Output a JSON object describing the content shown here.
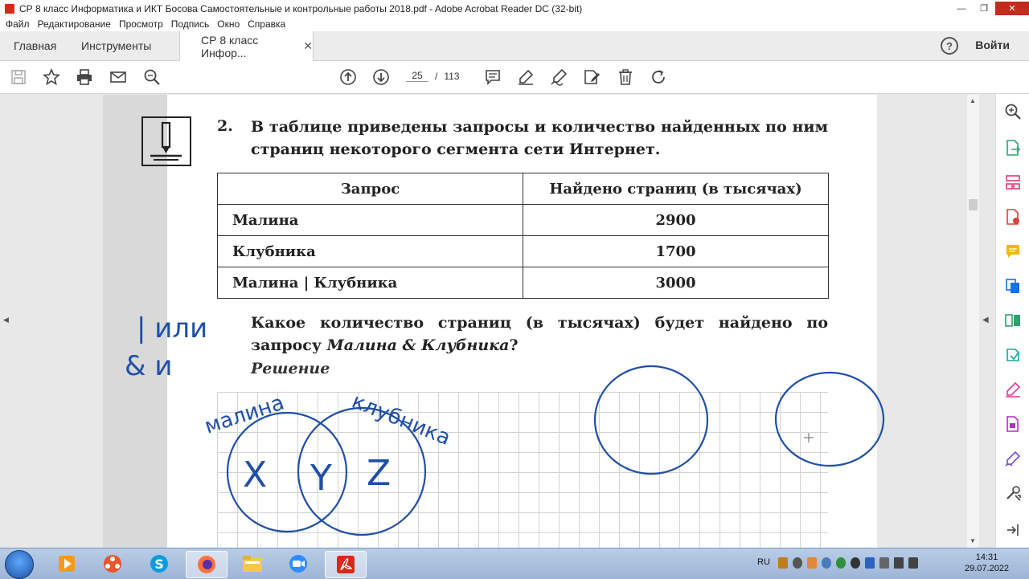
{
  "window": {
    "title": "СР 8 класс Информатика и ИКТ Босова Самостоятельные и контрольные работы 2018.pdf - Adobe Acrobat Reader DC (32-bit)",
    "minimize": "—",
    "maximize": "❐",
    "close": "✕"
  },
  "menu": [
    "Файл",
    "Редактирование",
    "Просмотр",
    "Подпись",
    "Окно",
    "Справка"
  ],
  "tabs": {
    "home": "Главная",
    "tools": "Инструменты",
    "document": "СР 8 класс Инфор...",
    "close": "✕"
  },
  "help": "?",
  "signin": "Войти",
  "pager": {
    "current": "25",
    "separator": "/",
    "total": "113"
  },
  "document": {
    "question_number": "2.",
    "question_text": "В таблице приведены запросы и количество найденных по ним страниц некоторого сегмента сети Интернет.",
    "table": {
      "headers": [
        "Запрос",
        "Найдено страниц (в тысячах)"
      ],
      "rows": [
        [
          "Малина",
          "2900"
        ],
        [
          "Клубника",
          "1700"
        ],
        [
          "Малина | Клубника",
          "3000"
        ]
      ]
    },
    "question2_prefix": "Какое количество страниц (в тысячах) будет найдено по запросу ",
    "question2_query": "Малина & Клубника",
    "question2_suffix": "?",
    "solution_label": "Решение"
  },
  "handwriting": {
    "or_note": "| или",
    "and_note": "& и",
    "set1": "малина",
    "set2": "клубника",
    "region_x": "X",
    "region_y": "Y",
    "region_z": "Z"
  },
  "taskbar": {
    "language": "RU",
    "time": "14:31",
    "date": "29.07.2022"
  },
  "colors": {
    "ink": "#1f4fa8",
    "acrobat_red": "#d7291a",
    "tool_blue": "#1473e6"
  }
}
